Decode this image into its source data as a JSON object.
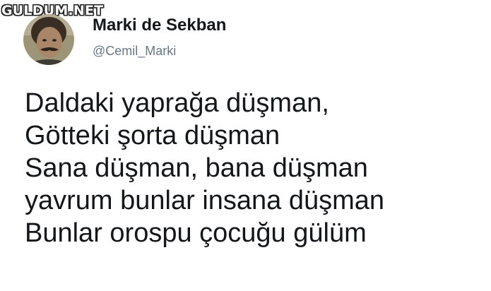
{
  "watermark": "GULDUM.NET",
  "author": {
    "display_name": "Marki de Sekban",
    "handle": "@Cemil_Marki",
    "avatar_icon": "profile-photo"
  },
  "tweet": {
    "lines": [
      "Daldaki yaprağa düşman,",
      "Götteki şorta düşman",
      "Sana düşman, bana düşman",
      "yavrum bunlar insana düşman",
      "Bunlar orospu çocuğu gülüm"
    ]
  },
  "colors": {
    "text": "#14171a",
    "secondary_text": "#657786",
    "background": "#ffffff"
  }
}
